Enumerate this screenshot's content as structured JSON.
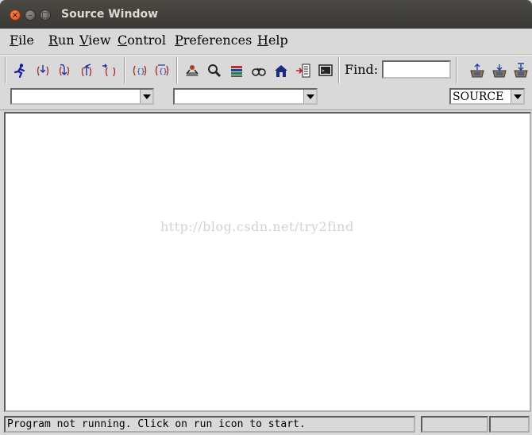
{
  "window": {
    "title": "Source Window"
  },
  "menubar": {
    "items": [
      {
        "label": "File",
        "mnemonic": "F"
      },
      {
        "label": "Run",
        "mnemonic": "R"
      },
      {
        "label": "View",
        "mnemonic": "V"
      },
      {
        "label": "Control",
        "mnemonic": "C"
      },
      {
        "label": "Preferences",
        "mnemonic": "P"
      },
      {
        "label": "Help",
        "mnemonic": "H"
      }
    ]
  },
  "toolbar": {
    "find_label": "Find:",
    "find_value": "",
    "icons": [
      "run-icon",
      "step-icon",
      "next-icon",
      "finish-icon",
      "continue-icon",
      "stepi-icon",
      "nexti-icon",
      "registers-icon",
      "memory-icon",
      "stack-icon",
      "watch-icon",
      "locals-icon",
      "breakpoints-icon",
      "console-icon",
      "up-stack-icon",
      "down-stack-icon",
      "bottom-stack-icon"
    ]
  },
  "combos": {
    "file": "",
    "function": "",
    "mode": "SOURCE"
  },
  "source": {
    "watermark": "http://blog.csdn.net/try2find"
  },
  "status": {
    "text": "Program not running. Click on run icon to start."
  },
  "colors": {
    "window_bg": "#d9d9d9",
    "titlebar": "#3c3b37",
    "close": "#e24c1a",
    "pane": "#ffffff"
  }
}
